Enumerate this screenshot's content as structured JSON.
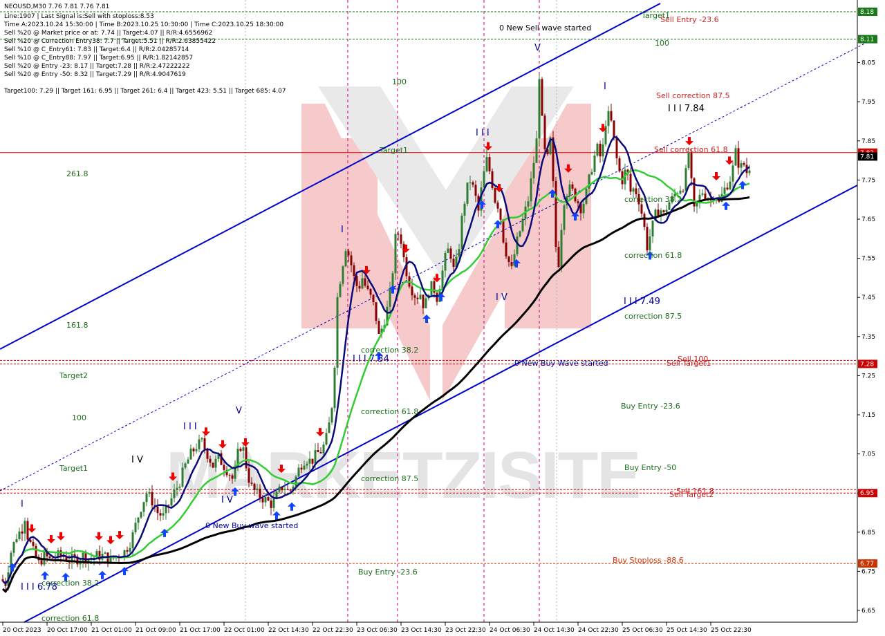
{
  "header": {
    "symbol_line": "NEOUSD,M30  7.76 7.81 7.76 7.81",
    "info_lines": [
      "Line:1907 | Last Signal is:Sell with stoploss:8.53",
      "Time A:2023.10.24 15:30:00 | Time B:2023.10.25 10:30:00 | Time C:2023.10.25 18:30:00",
      "Sell %20 @ Market price or at: 7.74 || Target:4.07 || R/R:4.6556962",
      "Sell %20 @ Correction Entry38: 7.7 || Target:5.51 || R/R:2.63855422",
      "Sell %10 @ C_Entry61: 7.83 || Target:6.4 || R/R:2.04285714",
      "Sell %10 @ C_Entry88: 7.97 || Target:6.95 || R/R:1.82142857",
      "Sell %20 @ Entry -23: 8.17 || Target:7.28 || R/R:2.47222222",
      "Sell %20 @ Entry -50: 8.32 || Target:7.29 || R/R:4.9047619",
      "Target100: 7.29 || Target 161: 6.95 || Target 261: 6.4 || Target 423: 5.51 || Target 685: 4.07"
    ]
  },
  "colors": {
    "background": "#ffffff",
    "candle_up": "#2e7d32",
    "candle_down": "#8b0000",
    "ma_fast": "#0a0a7a",
    "ma_mid": "#33cc33",
    "ma_slow": "#000000",
    "channel": "#0000cc",
    "hline_red": "#cc0000",
    "hline_green": "#1a7a1a",
    "hline_orange": "#cc3300",
    "vline_magenta": "#cc0077",
    "label_green": "#1a6e1a",
    "label_red": "#cc2222",
    "label_blue": "#000099",
    "arrow_up": "#1144ff",
    "arrow_down": "#ee0000",
    "watermark": "#f5b5b5"
  },
  "price_axis": {
    "ticks": [
      "8.05",
      "7.95",
      "7.85",
      "7.75",
      "7.65",
      "7.55",
      "7.45",
      "7.35",
      "7.25",
      "7.15",
      "7.05",
      "6.95",
      "6.85",
      "6.75",
      "6.65"
    ],
    "tags": [
      {
        "text": "8.18",
        "price": 8.18,
        "bg": "#1a7a1a"
      },
      {
        "text": "8.11",
        "price": 8.11,
        "bg": "#1a7a1a"
      },
      {
        "text": "7.82",
        "price": 7.82,
        "bg": "#cc0000"
      },
      {
        "text": "7.81",
        "price": 7.81,
        "bg": "#000000"
      },
      {
        "text": "7.28",
        "price": 7.28,
        "bg": "#cc0000"
      },
      {
        "text": "6.95",
        "price": 6.95,
        "bg": "#cc0000"
      },
      {
        "text": "6.77",
        "price": 6.77,
        "bg": "#cc3300"
      }
    ]
  },
  "time_axis": {
    "ticks": [
      "20 Oct 2023",
      "20 Oct 17:00",
      "21 Oct 01:00",
      "21 Oct 09:00",
      "21 Oct 17:00",
      "22 Oct 01:00",
      "22 Oct 14:30",
      "22 Oct 22:30",
      "23 Oct 06:30",
      "23 Oct 14:30",
      "23 Oct 22:30",
      "24 Oct 06:30",
      "24 Oct 14:30",
      "24 Oct 22:30",
      "25 Oct 06:30",
      "25 Oct 14:30",
      "25 Oct 22:30"
    ]
  },
  "annotations": {
    "new_sell_wave": "0 New Sell wave started",
    "new_buy_wave_1": "0 New Buy Wave started",
    "new_buy_wave_2": "0 New Buy wave started",
    "target1_top": "Target1",
    "sell_entry": "Sell Entry -23.6",
    "l100_top": "100",
    "l100_mid": "100",
    "l100_left": "100",
    "sell_corr_875": "Sell correction 87.5",
    "sell_corr_618": "Sell correction 61.8",
    "wave_784": "I I I 7.84",
    "wave_749": "I I I 7.49",
    "wave_734": "I I I 7.34",
    "wave_678": "I I I 6.78",
    "l2618": "261.8",
    "l1618": "161.8",
    "target2": "Target2",
    "target1_left": "Target1",
    "target1_mid": "Target1",
    "sell_100": "Sell 100",
    "sell_target1": "Sell Target1",
    "sell_1618": "Sell 161.8",
    "sell_target2": "Sell Target2",
    "buy_entry_236_right": "Buy Entry -23.6",
    "buy_entry_50": "Buy Entry -50",
    "buy_stoploss": "Buy Stoploss -88.6",
    "buy_entry_236_bottom": "Buy Entry -23.6",
    "corr_618_right": "correction 61.8",
    "corr_875_right": "correction 87.5",
    "corr_382_right": "correction 38.2",
    "corr_382_mid": "correction 38.2",
    "corr_618_mid": "correction 61.8",
    "corr_875_mid": "correction 87.5",
    "corr_382_left": "correction 38.2",
    "corr_618_left": "correction 61.8",
    "wave_i_1": "I",
    "wave_i_2": "I",
    "wave_i_3": "I",
    "wave_iii_1": "I I I",
    "wave_iii_2": "I I I",
    "wave_iv_1": "I V",
    "wave_iv_2": "I V",
    "wave_iv_3": "I V",
    "wave_v_1": "V",
    "wave_v_2": "V"
  },
  "watermark": {
    "text": "MARKETZISITE"
  },
  "chart_data": {
    "type": "candlestick",
    "symbol": "NEOUSD",
    "timeframe": "M30",
    "ohlc_last": {
      "open": 7.76,
      "high": 7.81,
      "low": 7.76,
      "close": 7.81
    },
    "ylim": [
      6.62,
      8.21
    ],
    "x_ticks": [
      "20 Oct 2023",
      "20 Oct 17:00",
      "21 Oct 01:00",
      "21 Oct 09:00",
      "21 Oct 17:00",
      "22 Oct 01:00",
      "22 Oct 14:30",
      "22 Oct 22:30",
      "23 Oct 06:30",
      "23 Oct 14:30",
      "23 Oct 22:30",
      "24 Oct 06:30",
      "24 Oct 14:30",
      "24 Oct 22:30",
      "25 Oct 06:30",
      "25 Oct 14:30",
      "25 Oct 22:30"
    ],
    "horizontal_levels": [
      {
        "price": 8.18,
        "label": "Target1",
        "color": "#1a7a1a"
      },
      {
        "price": 8.11,
        "label": "100",
        "color": "#1a7a1a"
      },
      {
        "price": 7.82,
        "label": "Sell correction 61.8",
        "color": "#cc0000"
      },
      {
        "price": 7.28,
        "label": "Sell 100",
        "color": "#cc0000"
      },
      {
        "price": 6.95,
        "label": "Sell 161.8",
        "color": "#cc0000"
      },
      {
        "price": 6.77,
        "label": "Buy Stoploss -88.6",
        "color": "#cc3300"
      }
    ],
    "price_path": [
      [
        0,
        6.73
      ],
      [
        8,
        6.72
      ],
      [
        16,
        6.8
      ],
      [
        24,
        6.84
      ],
      [
        32,
        6.86
      ],
      [
        36,
        6.89
      ],
      [
        40,
        6.84
      ],
      [
        48,
        6.8
      ],
      [
        56,
        6.77
      ],
      [
        64,
        6.79
      ],
      [
        72,
        6.78
      ],
      [
        80,
        6.79
      ],
      [
        90,
        6.79
      ],
      [
        100,
        6.78
      ],
      [
        110,
        6.78
      ],
      [
        120,
        6.79
      ],
      [
        130,
        6.78
      ],
      [
        140,
        6.79
      ],
      [
        150,
        6.79
      ],
      [
        160,
        6.78
      ],
      [
        170,
        6.79
      ],
      [
        180,
        6.8
      ],
      [
        190,
        6.83
      ],
      [
        198,
        6.88
      ],
      [
        205,
        6.92
      ],
      [
        212,
        6.95
      ],
      [
        220,
        6.93
      ],
      [
        228,
        6.9
      ],
      [
        236,
        6.89
      ],
      [
        244,
        6.92
      ],
      [
        252,
        6.95
      ],
      [
        260,
        6.98
      ],
      [
        268,
        7.02
      ],
      [
        276,
        7.05
      ],
      [
        284,
        7.07
      ],
      [
        292,
        7.08
      ],
      [
        300,
        7.05
      ],
      [
        308,
        7.02
      ],
      [
        316,
        7.04
      ],
      [
        324,
        7.02
      ],
      [
        332,
        7.0
      ],
      [
        338,
        6.98
      ],
      [
        344,
        7.05
      ],
      [
        350,
        7.08
      ],
      [
        356,
        7.02
      ],
      [
        362,
        6.97
      ],
      [
        370,
        6.95
      ],
      [
        378,
        6.94
      ],
      [
        386,
        6.93
      ],
      [
        394,
        6.92
      ],
      [
        402,
        6.95
      ],
      [
        410,
        6.97
      ],
      [
        418,
        6.95
      ],
      [
        426,
        6.98
      ],
      [
        434,
        7.02
      ],
      [
        442,
        7.04
      ],
      [
        450,
        7.03
      ],
      [
        458,
        7.05
      ],
      [
        466,
        7.06
      ],
      [
        474,
        7.1
      ],
      [
        482,
        7.2
      ],
      [
        488,
        7.45
      ],
      [
        494,
        7.52
      ],
      [
        500,
        7.58
      ],
      [
        506,
        7.55
      ],
      [
        512,
        7.5
      ],
      [
        518,
        7.47
      ],
      [
        524,
        7.5
      ],
      [
        530,
        7.47
      ],
      [
        536,
        7.45
      ],
      [
        542,
        7.42
      ],
      [
        548,
        7.35
      ],
      [
        554,
        7.38
      ],
      [
        560,
        7.42
      ],
      [
        566,
        7.48
      ],
      [
        572,
        7.6
      ],
      [
        578,
        7.62
      ],
      [
        584,
        7.55
      ],
      [
        590,
        7.5
      ],
      [
        596,
        7.47
      ],
      [
        602,
        7.45
      ],
      [
        608,
        7.46
      ],
      [
        614,
        7.42
      ],
      [
        620,
        7.47
      ],
      [
        626,
        7.48
      ],
      [
        632,
        7.45
      ],
      [
        638,
        7.5
      ],
      [
        644,
        7.55
      ],
      [
        650,
        7.58
      ],
      [
        656,
        7.52
      ],
      [
        662,
        7.55
      ],
      [
        668,
        7.65
      ],
      [
        674,
        7.72
      ],
      [
        680,
        7.75
      ],
      [
        686,
        7.72
      ],
      [
        692,
        7.67
      ],
      [
        698,
        7.75
      ],
      [
        704,
        7.8
      ],
      [
        710,
        7.76
      ],
      [
        716,
        7.7
      ],
      [
        722,
        7.68
      ],
      [
        728,
        7.6
      ],
      [
        734,
        7.55
      ],
      [
        740,
        7.52
      ],
      [
        746,
        7.58
      ],
      [
        752,
        7.62
      ],
      [
        758,
        7.66
      ],
      [
        764,
        7.7
      ],
      [
        770,
        7.77
      ],
      [
        776,
        7.85
      ],
      [
        780,
        8.02
      ],
      [
        784,
        7.9
      ],
      [
        790,
        7.78
      ],
      [
        796,
        7.85
      ],
      [
        802,
        7.68
      ],
      [
        806,
        7.48
      ],
      [
        810,
        7.6
      ],
      [
        816,
        7.7
      ],
      [
        822,
        7.73
      ],
      [
        828,
        7.72
      ],
      [
        834,
        7.7
      ],
      [
        840,
        7.68
      ],
      [
        846,
        7.7
      ],
      [
        852,
        7.75
      ],
      [
        858,
        7.8
      ],
      [
        864,
        7.83
      ],
      [
        870,
        7.8
      ],
      [
        876,
        7.9
      ],
      [
        882,
        7.92
      ],
      [
        888,
        7.85
      ],
      [
        894,
        7.78
      ],
      [
        900,
        7.75
      ],
      [
        906,
        7.78
      ],
      [
        912,
        7.72
      ],
      [
        918,
        7.73
      ],
      [
        924,
        7.7
      ],
      [
        930,
        7.65
      ],
      [
        936,
        7.58
      ],
      [
        942,
        7.62
      ],
      [
        948,
        7.66
      ],
      [
        954,
        7.68
      ],
      [
        960,
        7.66
      ],
      [
        966,
        7.69
      ],
      [
        972,
        7.7
      ],
      [
        978,
        7.72
      ],
      [
        984,
        7.73
      ],
      [
        990,
        7.74
      ],
      [
        996,
        7.82
      ],
      [
        1000,
        7.74
      ],
      [
        1004,
        7.67
      ],
      [
        1010,
        7.7
      ],
      [
        1016,
        7.72
      ],
      [
        1022,
        7.71
      ],
      [
        1028,
        7.7
      ],
      [
        1034,
        7.72
      ],
      [
        1040,
        7.69
      ],
      [
        1046,
        7.72
      ],
      [
        1052,
        7.74
      ],
      [
        1058,
        7.76
      ],
      [
        1064,
        7.82
      ],
      [
        1070,
        7.78
      ],
      [
        1076,
        7.79
      ],
      [
        1082,
        7.76
      ],
      [
        1086,
        7.81
      ]
    ]
  }
}
